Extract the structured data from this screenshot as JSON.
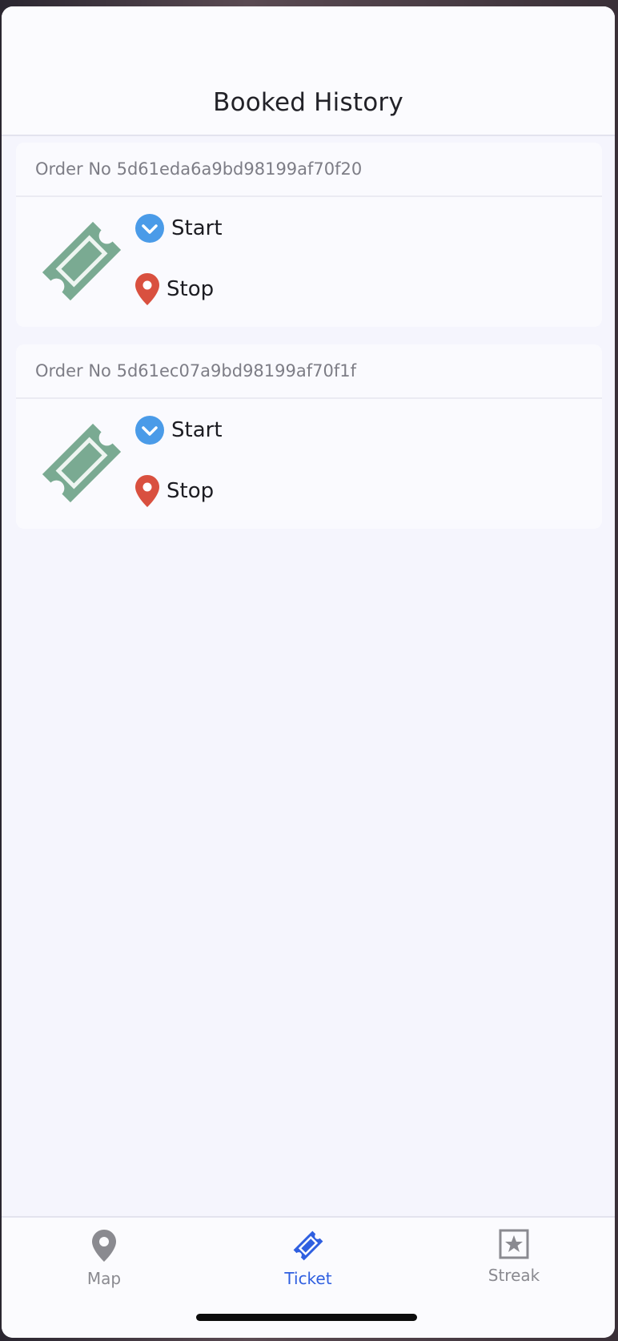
{
  "header": {
    "title": "Booked History"
  },
  "orders": [
    {
      "order_label": "Order No 5d61eda6a9bd98199af70f20",
      "start_label": "Start",
      "stop_label": "Stop"
    },
    {
      "order_label": "Order No 5d61ec07a9bd98199af70f1f",
      "start_label": "Start",
      "stop_label": "Stop"
    }
  ],
  "tabbar": {
    "tabs": [
      {
        "label": "Map",
        "icon": "map-pin-icon"
      },
      {
        "label": "Ticket",
        "icon": "ticket-icon",
        "active": true
      },
      {
        "label": "Streak",
        "icon": "star-box-icon"
      }
    ]
  },
  "colors": {
    "accent": "#2f5fe0",
    "ticket_green": "#7aaa92",
    "start_blue": "#4a9be8",
    "stop_red": "#d9503f"
  }
}
